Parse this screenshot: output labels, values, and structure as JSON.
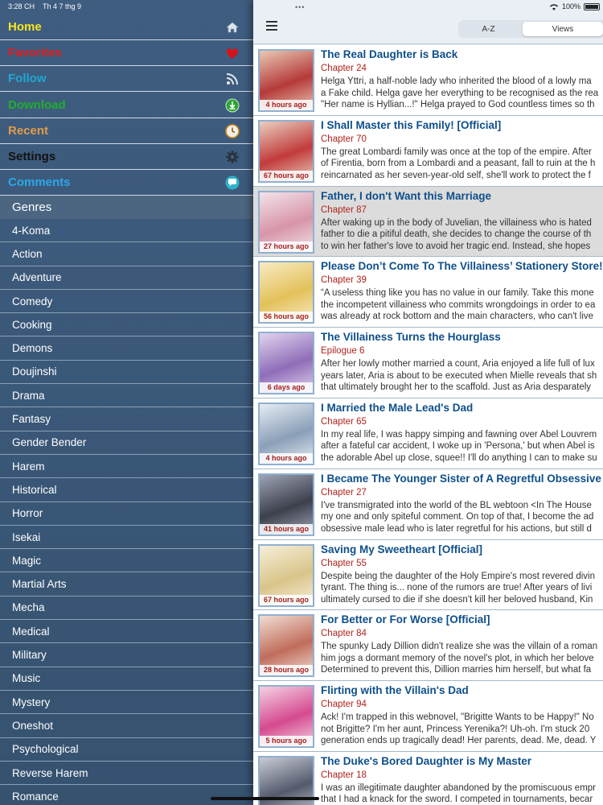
{
  "status": {
    "time": "3:28 CH",
    "date": "Th 4 7 thg 9",
    "battery": "100%"
  },
  "menu": [
    {
      "label": "Home",
      "color": "#f5e61e",
      "icon": "home-icon"
    },
    {
      "label": "Favorites",
      "color": "#e01e1e",
      "icon": "heart-icon"
    },
    {
      "label": "Follow",
      "color": "#1fa8d2",
      "icon": "rss-icon"
    },
    {
      "label": "Download",
      "color": "#1fae2e",
      "icon": "download-icon"
    },
    {
      "label": "Recent",
      "color": "#e39b4a",
      "icon": "clock-icon"
    },
    {
      "label": "Settings",
      "color": "#111111",
      "icon": "gear-icon"
    },
    {
      "label": "Comments",
      "color": "#2ba8e8",
      "icon": "chat-icon"
    }
  ],
  "genres_header": "Genres",
  "genres": [
    "4-Koma",
    "Action",
    "Adventure",
    "Comedy",
    "Cooking",
    "Demons",
    "Doujinshi",
    "Drama",
    "Fantasy",
    "Gender Bender",
    "Harem",
    "Historical",
    "Horror",
    "Isekai",
    "Magic",
    "Martial Arts",
    "Mecha",
    "Medical",
    "Military",
    "Music",
    "Mystery",
    "Oneshot",
    "Psychological",
    "Reverse Harem",
    "Romance"
  ],
  "sort": {
    "az": "A-Z",
    "views": "Views",
    "active": "Views"
  },
  "manga": [
    {
      "title": "The Real Daughter is Back",
      "chapter": "Chapter 24",
      "ago": "4 hours ago",
      "desc": [
        "Helga Yttri, a half-noble lady who inherited the blood of a lowly ma",
        "a Fake child. Helga gave her everything to be recognised as the rea",
        "\"Her name is Hyllian...!\" Helga prayed to God countless times so th"
      ],
      "c1": "#b53a3a",
      "c2": "#e9c9b5"
    },
    {
      "title": "I Shall Master this Family! [Official]",
      "chapter": "Chapter 70",
      "ago": "67 hours ago",
      "desc": [
        "The great Lombardi family was once at the top of the empire. After",
        "of Firentia, born from a Lombardi and a peasant, fall to ruin at the h",
        "reincarnated as her seven-year-old self, she'll work to protect the f"
      ],
      "c1": "#c23b3b",
      "c2": "#e8cfc0"
    },
    {
      "title": "Father, I don't Want this Marriage",
      "chapter": "Chapter 87",
      "ago": "27 hours ago",
      "highlight": true,
      "desc": [
        "After waking up in the body of Juvelian, the villainess who is hated",
        "father to die a pitiful death, she decides to change the course of th",
        "to win her father's love to avoid her tragic end. Instead, she hopes"
      ],
      "c1": "#d795a8",
      "c2": "#f3e3ea"
    },
    {
      "title": "Please Don’t Come To The Villainess’ Stationery Store!",
      "chapter": "Chapter 39",
      "ago": "56 hours ago",
      "desc": [
        "“A useless thing like you has no value in our family. Take this mone",
        "the incompetent villainess who commits wrongdoings in order to ea",
        "was already at rock bottom and the main characters, who can't live"
      ],
      "c1": "#e3c15a",
      "c2": "#f8ebc4"
    },
    {
      "title": "The Villainess Turns the Hourglass",
      "chapter": "Epilogue 6",
      "ago": "6 days ago",
      "desc": [
        "After her lowly mother married a count, Aria enjoyed a life full of lux",
        "years later, Aria is about to be executed when Mielle reveals that sh",
        "that ultimately brought her to the scaffold. Just as Aria desparately"
      ],
      "c1": "#8f6db8",
      "c2": "#e1d4ee"
    },
    {
      "title": "I Married the Male Lead's Dad",
      "chapter": "Chapter 65",
      "ago": "4 hours ago",
      "desc": [
        "In my real life, I was happy simping and fawning over Abel Louvrem",
        "after a fateful car accident, I woke up in 'Persona,' but when Abel is",
        "the adorable Abel up close, squee!! I'll do anything I can to make su"
      ],
      "c1": "#8a9fb8",
      "c2": "#e6ecf3"
    },
    {
      "title": "I Became The Younger Sister of A Regretful Obsessive M",
      "chapter": "Chapter 27",
      "ago": "41 hours ago",
      "desc": [
        "I've transmigrated into the world of the BL webtoon <In The House",
        "my one and only spiteful comment. On top of that, I become the ad",
        "obsessive male lead who is later regretful for his actions, but still d"
      ],
      "c1": "#3d3f4c",
      "c2": "#9ea4b5"
    },
    {
      "title": "Saving My Sweetheart [Official]",
      "chapter": "Chapter 55",
      "ago": "67 hours ago",
      "desc": [
        "Despite being the daughter of the Holy Empire's most revered divin",
        "tyrant. The thing is... none of the rumors are true! After years of livi",
        "ultimately cursed to die if she doesn't kill her beloved husband, Kin"
      ],
      "c1": "#d9c48a",
      "c2": "#f6efd9"
    },
    {
      "title": "For Better or For Worse [Official]",
      "chapter": "Chapter 84",
      "ago": "28 hours ago",
      "desc": [
        "The spunky Lady Dillion didn't realize she was the villain of a roman",
        "him jogs a dormant memory of the novel's plot, in which her belove",
        "Determined to prevent this, Dillion marries him herself, but what fa"
      ],
      "c1": "#c06d5c",
      "c2": "#f1ddd3"
    },
    {
      "title": "Flirting with the Villain's Dad",
      "chapter": "Chapter 94",
      "ago": "5 hours ago",
      "desc": [
        "Ack! I'm trapped in this webnovel, \"Brigitte Wants to be Happy!\" No",
        "not Brigitte? I'm her aunt, Princess Yerenika?! Uh-oh. I'm stuck 20",
        "generation ends up tragically dead! Her parents, dead. Me, dead. Y"
      ],
      "c1": "#d54a8f",
      "c2": "#f4d2e4"
    },
    {
      "title": "The Duke's Bored Daughter is My Master",
      "chapter": "Chapter 18",
      "ago": "",
      "desc": [
        "I was an illegitimate daughter abandoned by the promiscuous empr",
        "that I had a knack for the sword. I competed in tournaments, becar"
      ],
      "c1": "#545a6c",
      "c2": "#c9ccd6"
    }
  ]
}
